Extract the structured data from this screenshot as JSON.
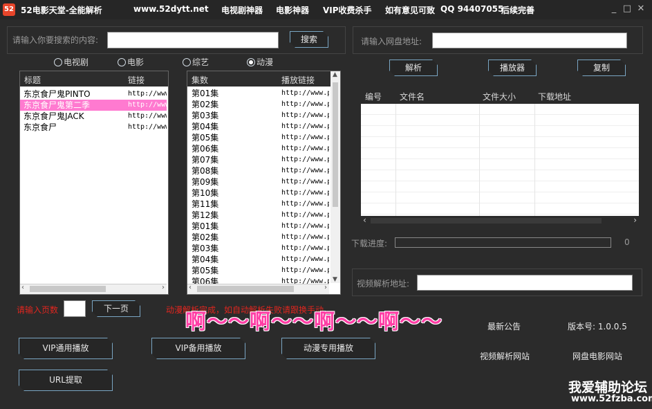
{
  "titlebar": {
    "logo": "52",
    "app_title": "52电影天堂-全能解析",
    "site": "www.52dytt.net",
    "tv_tool": "电视剧神器",
    "movie_tool": "电影神器",
    "vip_tool": "VIP收费杀手",
    "feedback": "如有意见可致",
    "qq": "QQ 94407055",
    "later": "后续完善",
    "minimize": "_",
    "maximize": "□",
    "close": "✕"
  },
  "search": {
    "label": "请输入你要搜索的内容:",
    "value": "",
    "button": "搜索"
  },
  "radios": [
    {
      "label": "电视剧",
      "checked": false
    },
    {
      "label": "电影",
      "checked": false
    },
    {
      "label": "综艺",
      "checked": false
    },
    {
      "label": "动漫",
      "checked": true
    }
  ],
  "title_list": {
    "headers": [
      "标题",
      "链接"
    ],
    "rows": [
      {
        "title": "东京食尸鬼PINTO",
        "link": "http://www",
        "selected": false
      },
      {
        "title": "东京食尸鬼第二季",
        "link": "http://www",
        "selected": true
      },
      {
        "title": "东京食尸鬼JACK",
        "link": "http://www",
        "selected": false
      },
      {
        "title": "东京食尸",
        "link": "http://www",
        "selected": false
      }
    ]
  },
  "episode_list": {
    "headers": [
      "集数",
      "播放链接"
    ],
    "rows": [
      {
        "ep": "第01集",
        "link": "http://www.p"
      },
      {
        "ep": "第02集",
        "link": "http://www.p"
      },
      {
        "ep": "第03集",
        "link": "http://www.p"
      },
      {
        "ep": "第04集",
        "link": "http://www.p"
      },
      {
        "ep": "第05集",
        "link": "http://www.p"
      },
      {
        "ep": "第06集",
        "link": "http://www.p"
      },
      {
        "ep": "第07集",
        "link": "http://www.p"
      },
      {
        "ep": "第08集",
        "link": "http://www.p"
      },
      {
        "ep": "第09集",
        "link": "http://www.p"
      },
      {
        "ep": "第10集",
        "link": "http://www.p"
      },
      {
        "ep": "第11集",
        "link": "http://www.p"
      },
      {
        "ep": "第12集",
        "link": "http://www.p"
      },
      {
        "ep": "第01集",
        "link": "http://www.p"
      },
      {
        "ep": "第02集",
        "link": "http://www.p"
      },
      {
        "ep": "第03集",
        "link": "http://www.p"
      },
      {
        "ep": "第04集",
        "link": "http://www.p"
      },
      {
        "ep": "第05集",
        "link": "http://www.p"
      },
      {
        "ep": "第06集",
        "link": "http://www.p"
      }
    ]
  },
  "paging": {
    "label": "请输入页数",
    "value": "",
    "next_button": "下一页",
    "status": "动漫解析完成，如自动解析失败请跟换手动",
    "overlay": "啊～～啊～～啊～～啊～～"
  },
  "play_buttons": {
    "vip_general": "VIP通用播放",
    "vip_backup": "VIP备用播放",
    "anime": "动漫专用播放",
    "url_extract": "URL提取"
  },
  "netdisk": {
    "label": "请输入网盘地址:",
    "value": "",
    "parse_button": "解析",
    "player_button": "播放器",
    "copy_button": "复制",
    "columns": [
      "编号",
      "文件名",
      "文件大小",
      "下载地址"
    ],
    "rows": []
  },
  "download": {
    "label": "下载进度:",
    "value": "0",
    "progress": 0
  },
  "video_parse": {
    "label": "视频解析地址:",
    "value": ""
  },
  "footer": {
    "announcement": "最新公告",
    "version": "版本号: 1.0.0.5",
    "video_site": "视频解析网站",
    "netdisk_site": "网盘电影网站",
    "watermark_title": "我爱辅助论坛",
    "watermark_url": "www.52fzba.com"
  }
}
